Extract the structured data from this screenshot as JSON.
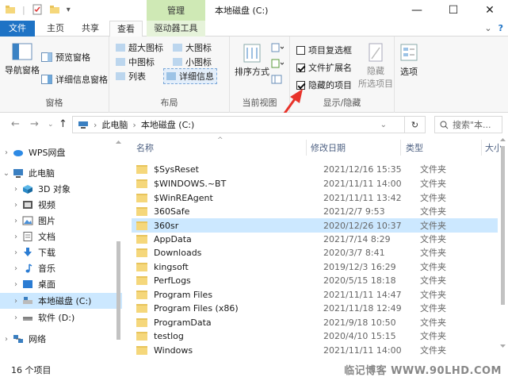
{
  "titlebar": {
    "context_tab": "管理",
    "title": "本地磁盘 (C:)",
    "min": "—",
    "max": "☐",
    "close": "✕"
  },
  "tabs": {
    "file": "文件",
    "home": "主页",
    "share": "共享",
    "view": "查看",
    "drive_tools": "驱动器工具",
    "chevron": "⌄",
    "help": "?"
  },
  "ribbon": {
    "pane_group": {
      "label": "窗格",
      "nav_pane": "导航窗格",
      "preview_pane": "预览窗格",
      "details_pane": "详细信息窗格"
    },
    "layout_group": {
      "label": "布局",
      "items": [
        "超大图标",
        "大图标",
        "中图标",
        "小图标",
        "列表",
        "详细信息"
      ]
    },
    "current_view_group": {
      "label": "当前视图",
      "sort_by": "排序方式"
    },
    "show_hide_group": {
      "label": "显示/隐藏",
      "item_checkboxes": "项目复选框",
      "file_extensions": "文件扩展名",
      "hidden_items": "隐藏的项目",
      "hide_selected_1": "隐藏",
      "hide_selected_2": "所选项目",
      "options": "选项"
    }
  },
  "address": {
    "crumbs": [
      "此电脑",
      "本地磁盘 (C:)"
    ],
    "search_placeholder": "搜索\"本..."
  },
  "nav": {
    "items": [
      "WPS网盘",
      "此电脑",
      "3D 对象",
      "视频",
      "图片",
      "文档",
      "下载",
      "音乐",
      "桌面",
      "本地磁盘 (C:)",
      "软件 (D:)",
      "网络"
    ]
  },
  "columns": {
    "name": "名称",
    "date": "修改日期",
    "type": "类型",
    "size": "大小"
  },
  "files": [
    {
      "name": "$SysReset",
      "date": "2021/12/16 15:35",
      "type": "文件夹"
    },
    {
      "name": "$WINDOWS.~BT",
      "date": "2021/11/11 14:00",
      "type": "文件夹"
    },
    {
      "name": "$WinREAgent",
      "date": "2021/11/11 13:42",
      "type": "文件夹"
    },
    {
      "name": "360Safe",
      "date": "2021/2/7 9:53",
      "type": "文件夹"
    },
    {
      "name": "360sr",
      "date": "2020/12/26 10:37",
      "type": "文件夹"
    },
    {
      "name": "AppData",
      "date": "2021/7/14 8:29",
      "type": "文件夹"
    },
    {
      "name": "Downloads",
      "date": "2020/3/7 8:41",
      "type": "文件夹"
    },
    {
      "name": "kingsoft",
      "date": "2019/12/3 16:29",
      "type": "文件夹"
    },
    {
      "name": "PerfLogs",
      "date": "2020/5/15 18:18",
      "type": "文件夹"
    },
    {
      "name": "Program Files",
      "date": "2021/11/11 14:47",
      "type": "文件夹"
    },
    {
      "name": "Program Files (x86)",
      "date": "2021/11/18 12:49",
      "type": "文件夹"
    },
    {
      "name": "ProgramData",
      "date": "2021/9/18 10:50",
      "type": "文件夹"
    },
    {
      "name": "testlog",
      "date": "2020/4/10 15:15",
      "type": "文件夹"
    },
    {
      "name": "Windows",
      "date": "2021/11/11 14:00",
      "type": "文件夹"
    }
  ],
  "status": {
    "count": "16 个项目",
    "watermark": "临记博客 WWW.90LHD.COM"
  },
  "colors": {
    "accent": "#1e73c5",
    "selection": "#cce8ff",
    "context_tab": "#cfe9b5",
    "arrow": "#e8332a"
  }
}
